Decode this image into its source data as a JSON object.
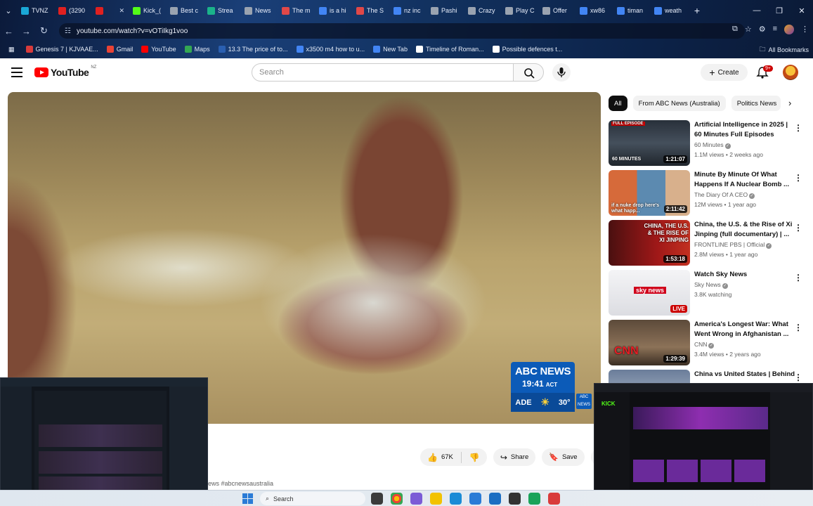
{
  "browser": {
    "tabs": [
      {
        "label": "TVNZ",
        "color": "#1aa7d6"
      },
      {
        "label": "(3290",
        "color": "#e02020"
      },
      {
        "label": "",
        "color": "#e02020"
      },
      {
        "label": "Kick_(",
        "color": "#53fc18"
      },
      {
        "label": "Best c",
        "color": "#9aa3b0"
      },
      {
        "label": "Strea",
        "color": "#1bb38a"
      },
      {
        "label": "News",
        "color": "#9aa3b0"
      },
      {
        "label": "The m",
        "color": "#e04848"
      },
      {
        "label": "is a hi",
        "color": "#4285f4"
      },
      {
        "label": "The S",
        "color": "#e04848"
      },
      {
        "label": "nz inc",
        "color": "#4285f4"
      },
      {
        "label": "Pashi",
        "color": "#9aa3b0"
      },
      {
        "label": "Crazy",
        "color": "#9aa3b0"
      },
      {
        "label": "Play C",
        "color": "#9aa3b0"
      },
      {
        "label": "Offer",
        "color": "#9aa3b0"
      },
      {
        "label": "xw86",
        "color": "#4285f4"
      },
      {
        "label": "timan",
        "color": "#4285f4"
      },
      {
        "label": "weath",
        "color": "#4285f4"
      }
    ],
    "url": "youtube.com/watch?v=vOTiIkg1voo",
    "bookmarks": [
      {
        "label": "Genesis 7 | KJVAAE...",
        "color": "#d93b3b"
      },
      {
        "label": "Gmail",
        "color": "#ea4335"
      },
      {
        "label": "YouTube",
        "color": "#ff0000"
      },
      {
        "label": "Maps",
        "color": "#34a853"
      },
      {
        "label": "13.3 The price of to...",
        "color": "#2a5fb0"
      },
      {
        "label": "x3500 m4 how to u...",
        "color": "#4285f4"
      },
      {
        "label": "New Tab",
        "color": "#4285f4"
      },
      {
        "label": "Timeline of Roman...",
        "color": "#ffffff"
      },
      {
        "label": "Possible defences t...",
        "color": "#ffffff"
      }
    ],
    "all_bookmarks": "All Bookmarks"
  },
  "youtube": {
    "logo": "YouTube",
    "country": "NZ",
    "search_placeholder": "Search",
    "create_label": "Create",
    "notification_badge": "9+"
  },
  "overlay": {
    "brand": "ABC NEWS",
    "time": "19:41",
    "tz": "ACT",
    "city": "ADE",
    "temp": "30°",
    "small": "ABC NEWS"
  },
  "chips": [
    "All",
    "From ABC News (Australia)",
    "Politics News"
  ],
  "recommendations": [
    {
      "title": "Artificial Intelligence in 2025 | 60 Minutes Full Episodes",
      "channel": "60 Minutes",
      "meta": "1.1M views • 2 weeks ago",
      "duration": "1:21:07",
      "thumb_text": "60 MINUTES",
      "tag": "FULL EPISODE"
    },
    {
      "title": "Minute By Minute Of What Happens If A Nuclear Bomb ...",
      "channel": "The Diary Of A CEO",
      "meta": "12M views • 1 year ago",
      "duration": "2:11:42",
      "thumb_text": "if a nuke drop here's what happ..."
    },
    {
      "title": "China, the U.S. & the Rise of Xi Jinping (full documentary) | ...",
      "channel": "FRONTLINE PBS | Official",
      "meta": "2.8M views • 1 year ago",
      "duration": "1:53:18",
      "thumb_text": "CHINA, THE U.S. & THE RISE OF XI JINPING"
    },
    {
      "title": "Watch Sky News",
      "channel": "Sky News",
      "meta": "3.8K watching",
      "duration": "LIVE",
      "thumb_text": "sky news"
    },
    {
      "title": "America's Longest War: What Went Wrong in Afghanistan ...",
      "channel": "CNN",
      "meta": "3.4M views • 2 years ago",
      "duration": "1:29:39",
      "thumb_text": "CNN"
    },
    {
      "title": "China vs United States | Behind",
      "channel": "",
      "meta": "",
      "duration": "",
      "thumb_text": ""
    }
  ],
  "actions": {
    "likes": "67K",
    "share": "Share",
    "save": "Save"
  },
  "hashtags": "ews #abcnewsaustralia",
  "taskbar": {
    "search": "Search"
  },
  "pip_right": {
    "brand": "KICK"
  }
}
